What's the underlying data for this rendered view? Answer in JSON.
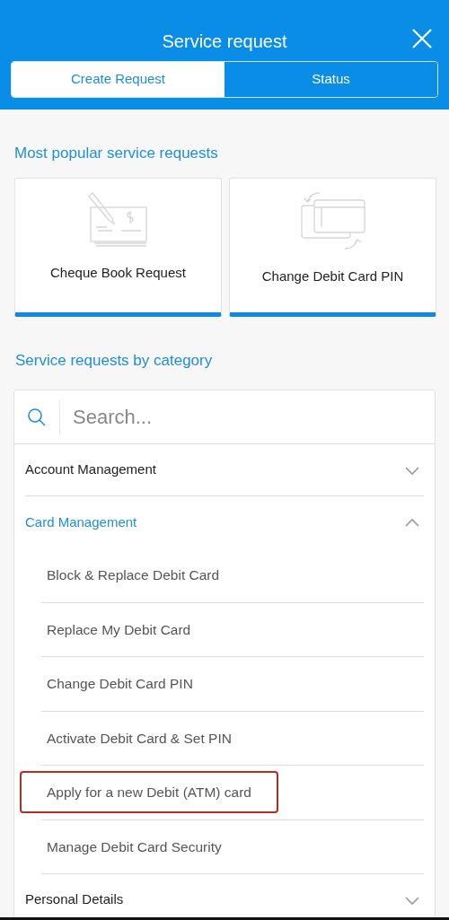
{
  "header": {
    "title": "Service request"
  },
  "tabs": [
    {
      "label": "Create Request",
      "selected": true
    },
    {
      "label": "Status",
      "selected": false
    }
  ],
  "popular": {
    "title": "Most popular service requests",
    "items": [
      {
        "label": "Cheque Book Request",
        "kind": "cheque"
      },
      {
        "label": "Change Debit Card PIN",
        "kind": "card"
      }
    ]
  },
  "categories": {
    "title": "Service requests by category",
    "search": {
      "placeholder": "Search..."
    },
    "groups": [
      {
        "label": "Account Management",
        "expanded": false
      },
      {
        "label": "Card Management",
        "expanded": true,
        "children": [
          {
            "label": "Block & Replace Debit Card",
            "highlighted": false
          },
          {
            "label": "Replace My Debit Card",
            "highlighted": false
          },
          {
            "label": "Change Debit Card PIN",
            "highlighted": false
          },
          {
            "label": "Activate Debit Card & Set PIN",
            "highlighted": false
          },
          {
            "label": "Apply for a new Debit (ATM) card",
            "highlighted": true
          },
          {
            "label": "Manage Debit Card Security",
            "highlighted": false
          }
        ]
      },
      {
        "label": "Personal Details",
        "expanded": false
      }
    ]
  }
}
